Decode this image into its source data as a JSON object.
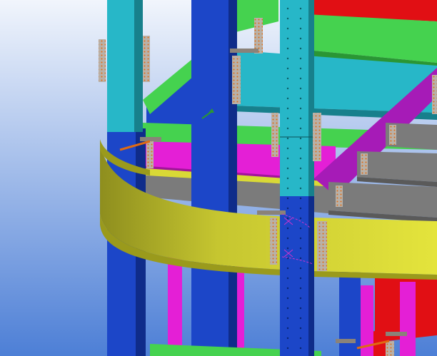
{
  "viewport": {
    "kind": "3d-structural-steel-model-view",
    "background": {
      "top": "#f1f5fc",
      "bottom": "#4d7fd6"
    }
  },
  "members": {
    "column_cyan": "#27b7c8",
    "column_cyan_dark": "#17808c",
    "column_blue": "#1c46c8",
    "column_blue_dark": "#0f2c8a",
    "beam_green": "#45d24f",
    "beam_green_dark": "#2a9634",
    "beam_magenta": "#e41fd6",
    "beam_magenta_dark": "#a0149a",
    "brace_purple": "#a61bb7",
    "beam_yellow": "#d9d936",
    "beam_yellow_dark": "#9a9a1c",
    "beam_gray": "#7b7b7b",
    "beam_gray_dark": "#5a5a5a",
    "beam_red": "#e10f14",
    "beam_red_dark": "#a50a0d",
    "plate_gray": "#b9b1a8",
    "bolt_orange": "#e06a12",
    "weld_red": "#ff3300"
  },
  "icons": {
    "cursor": "axis-cursor-icon"
  }
}
